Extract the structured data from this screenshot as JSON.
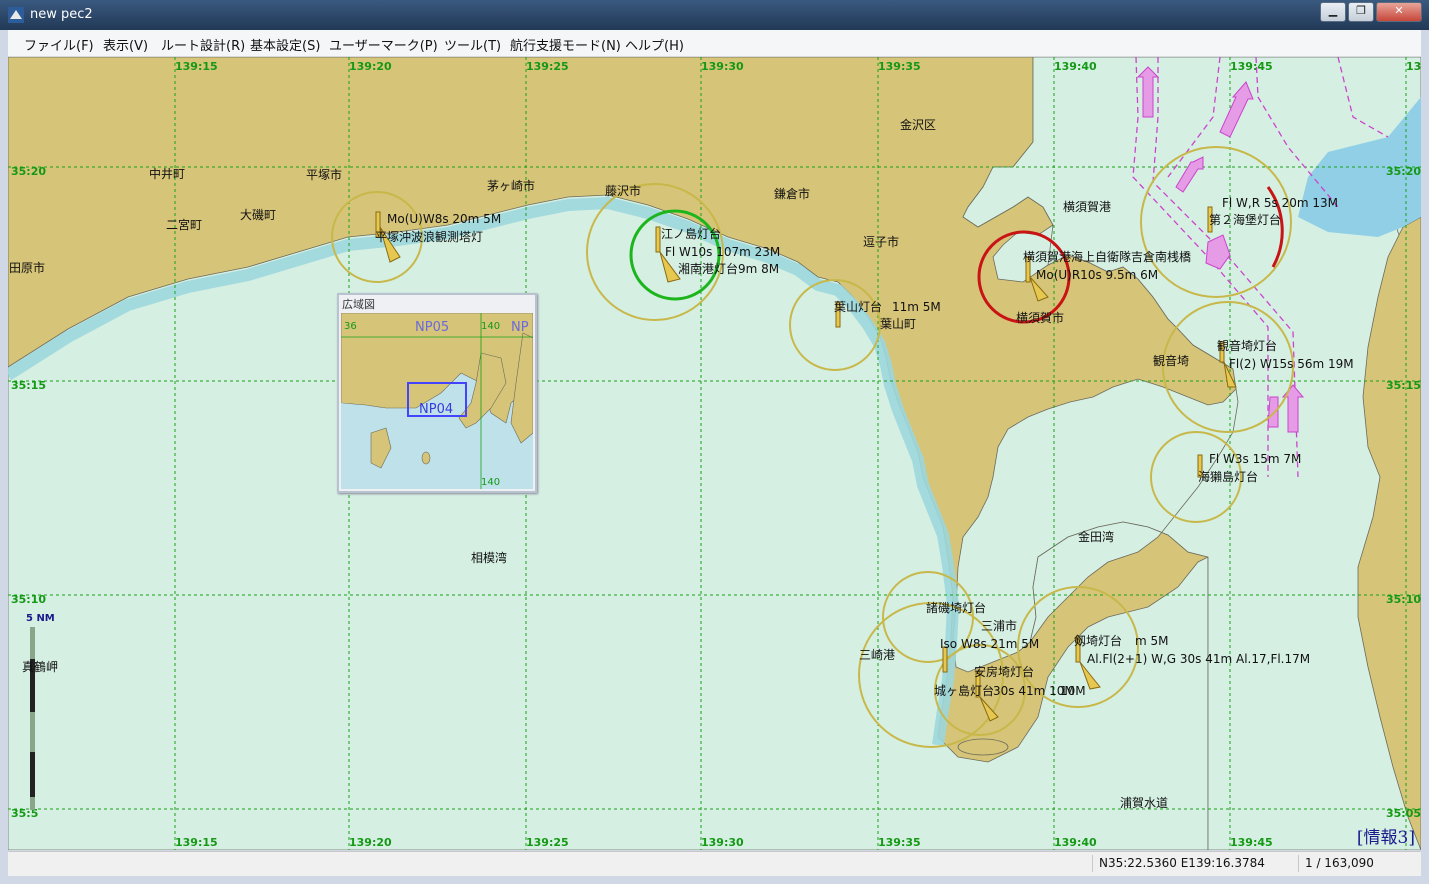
{
  "window": {
    "title": "new pec2",
    "buttons": [
      "▁",
      "❐",
      "✕"
    ]
  },
  "menu": [
    "ファイル(F)",
    "表示(V)",
    "ルート設計(R)",
    "基本設定(S)",
    "ユーザーマーク(P)",
    "ツール(T)",
    "航行支援モード(N)",
    "ヘルプ(H)"
  ],
  "colors": {
    "land": "#d6c478",
    "shallow": "#bfe6e8",
    "deep": "#d5efe3",
    "grid": "#16a316",
    "route": "#cc44cc",
    "range_ring": "#c8b84a",
    "highlight_red": "#c81414",
    "highlight_green": "#1cb61c"
  },
  "grid": {
    "lon_top": [
      "139:15",
      "139:20",
      "139:25",
      "139:30",
      "139:35",
      "139:40",
      "139:45",
      "13"
    ],
    "lon_bottom": [
      "139:15",
      "139:20",
      "139:25",
      "139:30",
      "139:35",
      "139:40",
      "139:45"
    ],
    "lat_left": [
      "35:20",
      "35:15",
      "35:10",
      "35:5"
    ],
    "lat_right": [
      "35:20",
      "35:15",
      "35:10",
      "35:05"
    ]
  },
  "places": {
    "kanazawa": "金沢区",
    "yokosuka_port": "横須賀港",
    "zushi": "逗子市",
    "kamakura": "鎌倉市",
    "fujisawa": "藤沢市",
    "chigasaki": "茅ヶ崎市",
    "hiratsuka": "平塚市",
    "nakai": "中井町",
    "oiso": "大磯町",
    "ninomiya": "二宮町",
    "odawara": "田原市",
    "hayama": "葉山町",
    "yokosuka_city": "横須賀市",
    "kannonzaki": "観音埼",
    "kanedawan": "金田湾",
    "miura": "三浦市",
    "misaki": "三崎港",
    "sagamiwan": "相模湾",
    "uraga": "浦賀水道",
    "manazuru": "真鶴岬"
  },
  "lights": {
    "hiratsuka_light": "平塚沖波浪観測塔灯",
    "hiratsuka_char": "Mo(U)W8s 20m 5M",
    "enoshima_light": "江ノ島灯台",
    "enoshima_char": "Fl W10s 107m 23M",
    "shonan_light": "湘南港灯台",
    "shonan_char": "9m 8M",
    "hayama_light": "葉山灯台",
    "hayama_char": "11m 5M",
    "yokosuka_naval": "横須賀港海上自衛隊吉倉南桟橋",
    "yokosuka_naval_char": "Mo(U)R10s 9.5m 6M",
    "daini_kaiho": "第２海堡灯台",
    "daini_kaiho_char": "Fl W,R 5s 20m 13M",
    "kannonzaki_light": "観音埼灯台",
    "kannonzaki_char": "Fl(2) W15s 56m 19M",
    "umihotaru": "海獺島灯台",
    "umihotaru_char": "Fl W3s 15m 7M",
    "moroiso": "諸磯埼灯台",
    "moroiso_char": "Iso W8s 21m 5M",
    "awasaki": "安房埼灯台",
    "awasaki_char": "10M",
    "jogashima": "城ヶ島灯台",
    "jogashima_char": "30s 41m 10M",
    "tsurugisaki": "剱埼灯台",
    "tsurugisaki_char": "m 5M",
    "tsurugisaki_char2": "Al.Fl(2+1) W,G 30s 41m Al.17,Fl.17M"
  },
  "overview": {
    "title": "広域図",
    "lat": "36",
    "lon": "140",
    "chart1": "NP05",
    "chart2": "NP",
    "selected": "NP04",
    "bottom_lon": "140"
  },
  "scale_bar": "5 NM",
  "status": {
    "coords": "N35:22.5360 E139:16.3784",
    "scale": "1 / 163,090",
    "info_tag": "[情報3]"
  }
}
